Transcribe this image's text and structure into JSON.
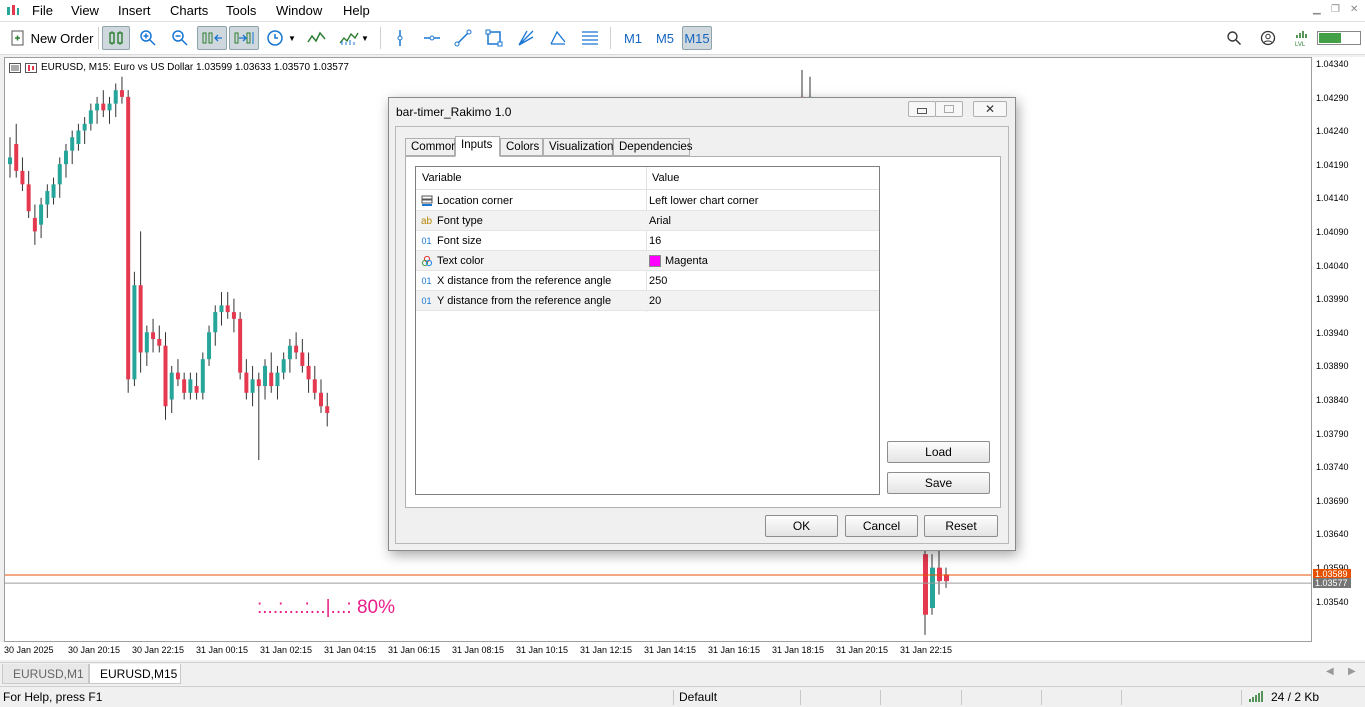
{
  "menu": [
    "File",
    "View",
    "Insert",
    "Charts",
    "Tools",
    "Window",
    "Help"
  ],
  "toolbar": {
    "new_order": "New Order",
    "timeframes": [
      "M1",
      "M5",
      "M15"
    ],
    "active_timeframe": "M15"
  },
  "chart": {
    "header": "EURUSD, M15:  Euro vs US Dollar  1.03599 1.03633 1.03570 1.03577",
    "timer_text": ":...:....:...|...:  80%",
    "price_tag_ask": "1.03589",
    "price_tag_bid": "1.03577",
    "y_ticks": [
      "1.04340",
      "1.04290",
      "1.04240",
      "1.04190",
      "1.04140",
      "1.04090",
      "1.04040",
      "1.03990",
      "1.03940",
      "1.03890",
      "1.03840",
      "1.03790",
      "1.03740",
      "1.03690",
      "1.03640",
      "1.03590",
      "1.03540"
    ],
    "x_ticks": [
      "30 Jan 2025",
      "30 Jan 20:15",
      "30 Jan 22:15",
      "31 Jan 00:15",
      "31 Jan 02:15",
      "31 Jan 04:15",
      "31 Jan 06:15",
      "31 Jan 08:15",
      "31 Jan 10:15",
      "31 Jan 12:15",
      "31 Jan 14:15",
      "31 Jan 16:15",
      "31 Jan 18:15",
      "31 Jan 20:15",
      "31 Jan 22:15"
    ],
    "colors": {
      "bull": "#26a69a",
      "bear": "#e53950",
      "ask_line": "#e65100",
      "bid_line": "#9e9e9e",
      "timer": "#e91e8a"
    }
  },
  "dialog": {
    "title": "bar-timer_Rakimo 1.0",
    "tabs": [
      "Common",
      "Inputs",
      "Colors",
      "Visualization",
      "Dependencies"
    ],
    "active_tab": "Inputs",
    "columns": {
      "variable": "Variable",
      "value": "Value"
    },
    "rows": [
      {
        "icon": "location-icon",
        "variable": "Location corner",
        "value": "Left lower chart corner"
      },
      {
        "icon": "font-type-icon",
        "variable": "Font type",
        "value": "Arial"
      },
      {
        "icon": "integer-icon",
        "variable": "Font size",
        "value": "16"
      },
      {
        "icon": "color-icon",
        "variable": "Text color",
        "value": "Magenta"
      },
      {
        "icon": "integer-icon",
        "variable": "X distance from the reference angle",
        "value": "250"
      },
      {
        "icon": "integer-icon",
        "variable": "Y distance from the reference angle",
        "value": "20"
      }
    ],
    "text_color_swatch": "#ff00ff",
    "buttons": {
      "load": "Load",
      "save": "Save",
      "ok": "OK",
      "cancel": "Cancel",
      "reset": "Reset"
    }
  },
  "chart_tabs": [
    "EURUSD,M1",
    "EURUSD,M15"
  ],
  "active_chart_tab": "EURUSD,M15",
  "status": {
    "help": "For Help, press F1",
    "profile": "Default",
    "traffic": "24 / 2 Kb"
  }
}
